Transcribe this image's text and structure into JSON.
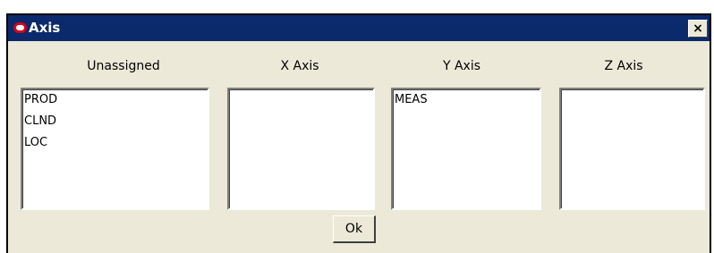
{
  "window": {
    "title": "Axis",
    "close_label": "×"
  },
  "columns": [
    {
      "header": "Unassigned",
      "items": [
        "PROD",
        "CLND",
        "LOC"
      ]
    },
    {
      "header": "X Axis",
      "items": []
    },
    {
      "header": "Y Axis",
      "items": [
        "MEAS"
      ]
    },
    {
      "header": "Z Axis",
      "items": []
    }
  ],
  "buttons": {
    "ok_label": "Ok"
  },
  "colors": {
    "titlebar": "#0a2a6b",
    "dialog_bg": "#ece9d8",
    "logo_red": "#d6001c"
  },
  "icons": {
    "app_logo": "oracle-logo-icon"
  }
}
